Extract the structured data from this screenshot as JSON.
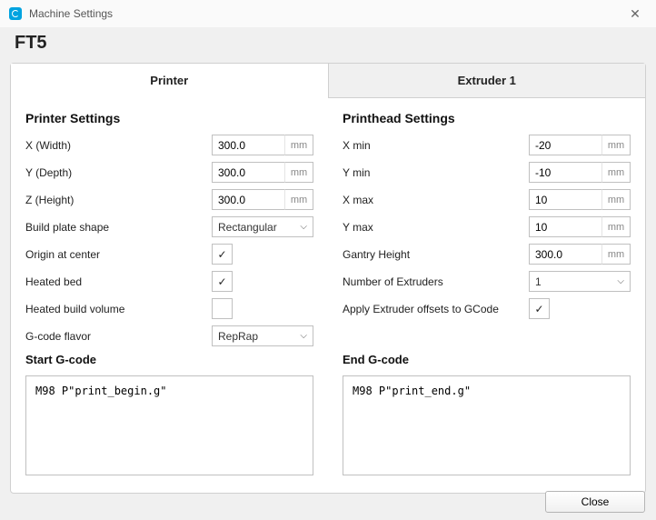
{
  "titlebar": {
    "title": "Machine Settings",
    "close_glyph": "✕"
  },
  "subheader": {
    "machine_name": "FT5"
  },
  "tabs": {
    "printer": "Printer",
    "extruder1": "Extruder 1"
  },
  "printer_settings": {
    "heading": "Printer Settings",
    "x_width": {
      "label": "X (Width)",
      "value": "300.0",
      "unit": "mm"
    },
    "y_depth": {
      "label": "Y (Depth)",
      "value": "300.0",
      "unit": "mm"
    },
    "z_height": {
      "label": "Z (Height)",
      "value": "300.0",
      "unit": "mm"
    },
    "build_plate_shape": {
      "label": "Build plate shape",
      "value": "Rectangular"
    },
    "origin_center": {
      "label": "Origin at center",
      "checked": true
    },
    "heated_bed": {
      "label": "Heated bed",
      "checked": true
    },
    "heated_volume": {
      "label": "Heated build volume",
      "checked": false
    },
    "gcode_flavor": {
      "label": "G-code flavor",
      "value": "RepRap"
    }
  },
  "printhead_settings": {
    "heading": "Printhead Settings",
    "x_min": {
      "label": "X min",
      "value": "-20",
      "unit": "mm"
    },
    "y_min": {
      "label": "Y min",
      "value": "-10",
      "unit": "mm"
    },
    "x_max": {
      "label": "X max",
      "value": "10",
      "unit": "mm"
    },
    "y_max": {
      "label": "Y max",
      "value": "10",
      "unit": "mm"
    },
    "gantry_height": {
      "label": "Gantry Height",
      "value": "300.0",
      "unit": "mm"
    },
    "extruder_count": {
      "label": "Number of Extruders",
      "value": "1"
    },
    "apply_offsets": {
      "label": "Apply Extruder offsets to GCode",
      "checked": true
    }
  },
  "start_gcode": {
    "heading": "Start G-code",
    "value": "M98 P\"print_begin.g\""
  },
  "end_gcode": {
    "heading": "End G-code",
    "value": "M98 P\"print_end.g\""
  },
  "footer": {
    "close_label": "Close"
  },
  "glyphs": {
    "check": "✓",
    "chevron": "⌵"
  }
}
